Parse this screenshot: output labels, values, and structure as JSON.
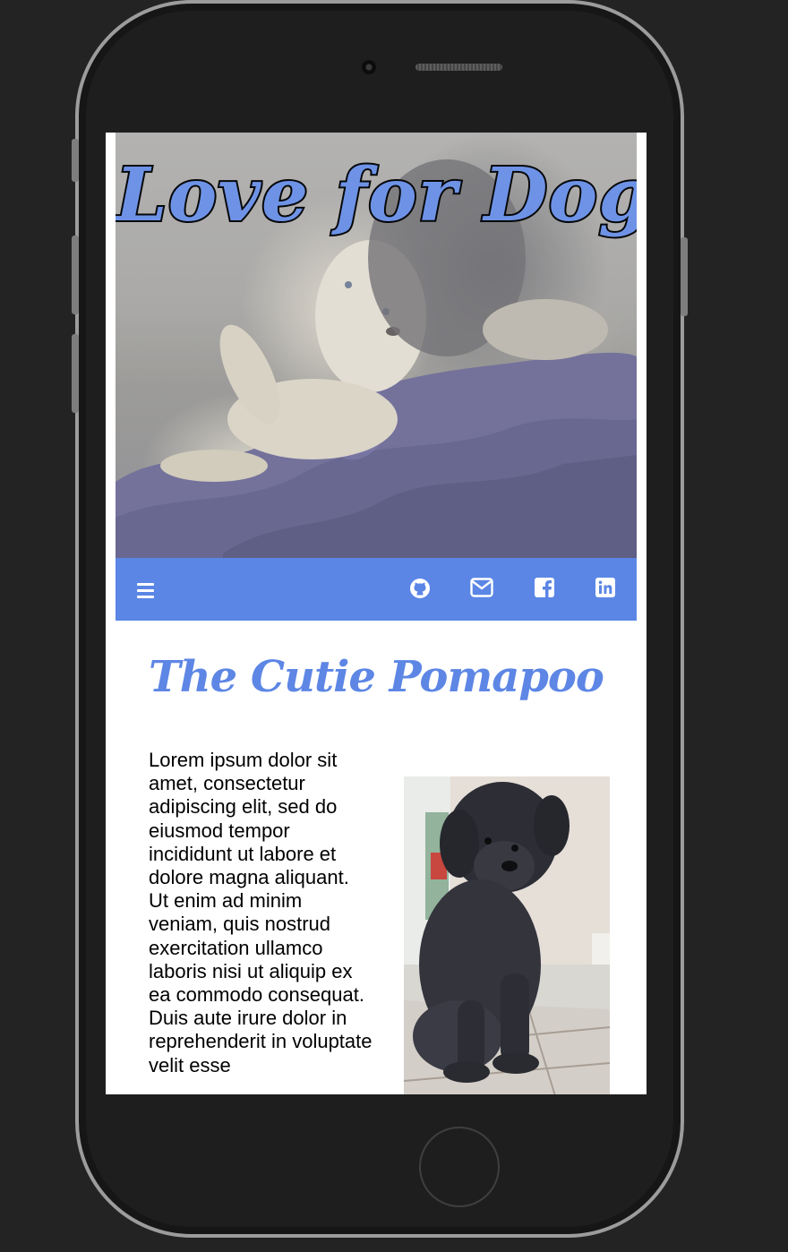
{
  "hero": {
    "title": "Love for Dogs"
  },
  "navbar": {
    "icons": [
      "menu-icon",
      "github-icon",
      "mail-icon",
      "facebook-icon",
      "linkedin-icon"
    ],
    "background": "#5b86e5"
  },
  "post": {
    "title": "The Cutie Pomapoo",
    "body": "Lorem ipsum dolor sit amet, consectetur adipiscing elit, sed do eiusmod tempor incididunt ut labore et dolore magna aliquant. Ut enim ad minim veniam, quis nostrud exercitation ullamco laboris nisi ut aliquip ex ea commodo consequat. Duis aute irure dolor in reprehenderit in voluptate velit esse"
  },
  "colors": {
    "accent": "#5d86e5",
    "page_background": "#232323",
    "screen_background": "#ffffff"
  }
}
